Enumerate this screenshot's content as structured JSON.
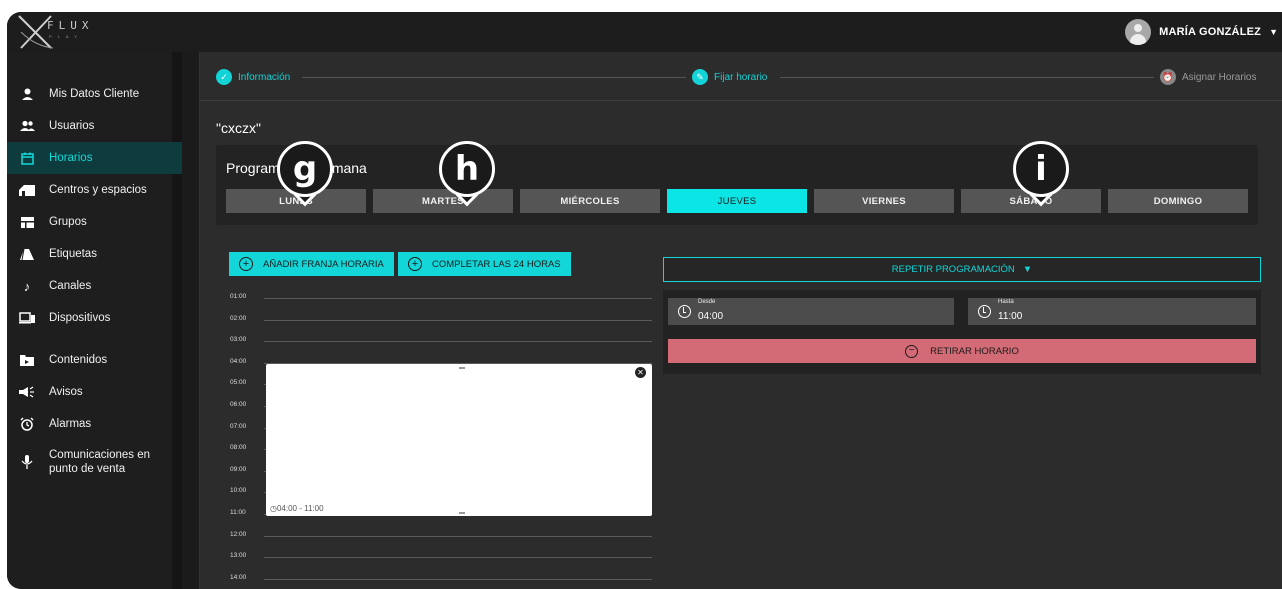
{
  "brand": {
    "logo_top": "FLUX",
    "logo_bottom": "PLAY"
  },
  "user": {
    "name": "MARÍA GONZÁLEZ"
  },
  "sidebar": {
    "items": [
      {
        "label": "Mis Datos Cliente",
        "icon": "user-icon"
      },
      {
        "label": "Usuarios",
        "icon": "users-icon"
      },
      {
        "label": "Horarios",
        "icon": "calendar-icon",
        "active": true
      },
      {
        "label": "Centros y espacios",
        "icon": "store-icon"
      },
      {
        "label": "Grupos",
        "icon": "groups-icon"
      },
      {
        "label": "Etiquetas",
        "icon": "tag-icon"
      },
      {
        "label": "Canales",
        "icon": "music-note-icon"
      },
      {
        "label": "Dispositivos",
        "icon": "devices-icon"
      },
      {
        "label": "Contenidos",
        "icon": "folder-icon"
      },
      {
        "label": "Avisos",
        "icon": "megaphone-icon"
      },
      {
        "label": "Alarmas",
        "icon": "alarm-icon"
      },
      {
        "label_1": "Comunicaciones en",
        "label_2": "punto de venta",
        "icon": "microphone-icon"
      }
    ]
  },
  "stepper": {
    "steps": [
      {
        "label": "Información",
        "state": "done"
      },
      {
        "label": "Fijar horario",
        "state": "current"
      },
      {
        "label": "Asignar Horarios",
        "state": "todo"
      }
    ]
  },
  "schedule": {
    "name": "\"cxczx\""
  },
  "week": {
    "title": "Programación semana",
    "days": [
      "LUNES",
      "MARTES",
      "MIÉRCOLES",
      "JUEVES",
      "VIERNES",
      "SÁBADO",
      "DOMINGO"
    ],
    "active_day": "JUEVES"
  },
  "markers": [
    "g",
    "h",
    "i"
  ],
  "actions": {
    "add_slot": "AÑADIR FRANJA HORARIA",
    "complete_24h": "COMPLETAR LAS 24 HORAS",
    "repeat": "REPETIR PROGRAMACIÓN",
    "remove": "RETIRAR HORARIO"
  },
  "timeline": {
    "hours": [
      "01:00",
      "02:00",
      "03:00",
      "04:00",
      "05:00",
      "06:00",
      "07:00",
      "08:00",
      "09:00",
      "10:00",
      "11:00",
      "12:00",
      "13:00",
      "14:00"
    ],
    "slot_range": "04:00 - 11:00"
  },
  "range": {
    "from_label": "Desde",
    "from_value": "04:00",
    "to_label": "Hasta",
    "to_value": "11:00"
  },
  "colors": {
    "accent": "#12d6d8",
    "danger": "#d26b75",
    "active_nav_bg": "#0e3c3e"
  }
}
